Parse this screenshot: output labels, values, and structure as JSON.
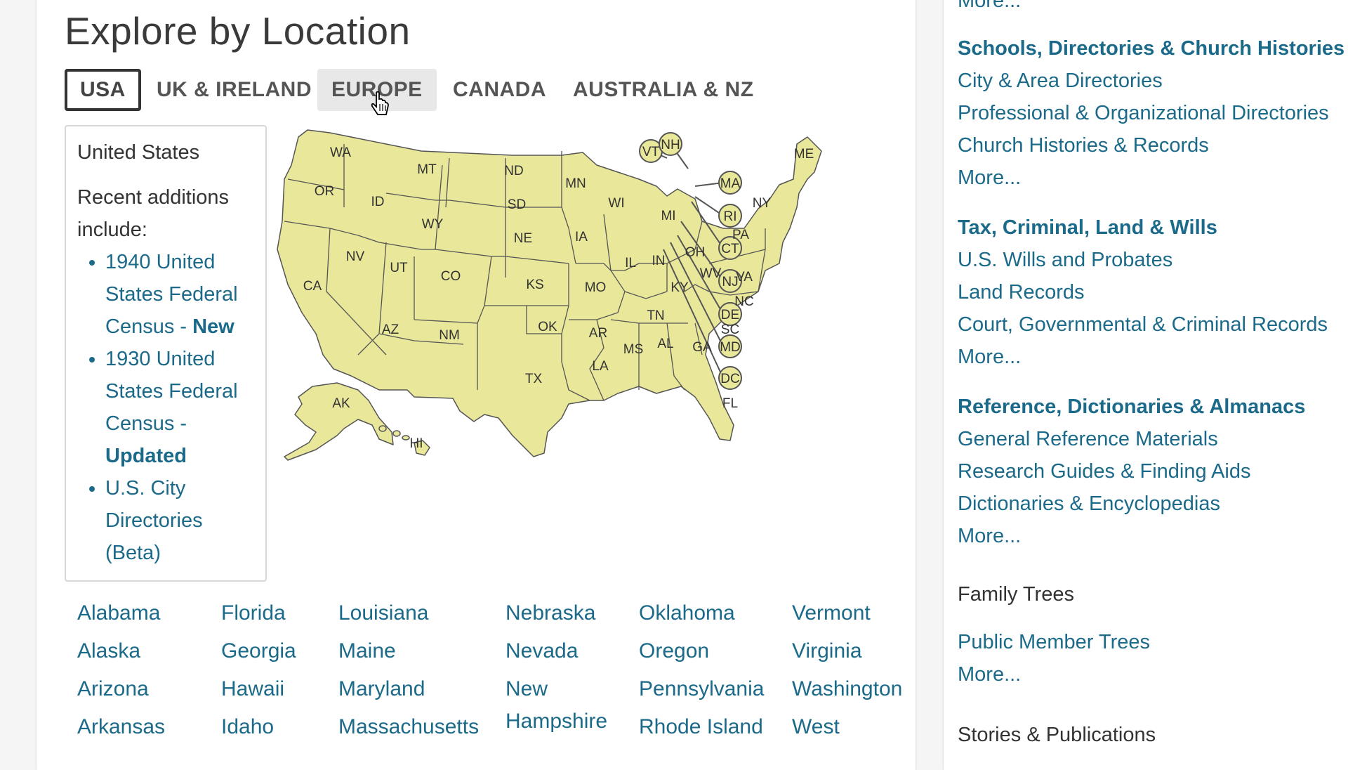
{
  "page": {
    "title": "Explore by Location",
    "tabs": [
      "USA",
      "UK & IRELAND",
      "EUROPE",
      "CANADA",
      "AUSTRALIA & NZ"
    ]
  },
  "info_box": {
    "heading": "United States",
    "intro": "Recent additions include:",
    "items": [
      {
        "text": "1940 United States Federal Census - ",
        "badge": "New"
      },
      {
        "text": "1930 United States Federal Census - ",
        "badge": "Updated"
      },
      {
        "text": "U.S. City Directories (Beta)",
        "badge": ""
      }
    ]
  },
  "map": {
    "states": [
      "WA",
      "OR",
      "CA",
      "ID",
      "NV",
      "MT",
      "WY",
      "UT",
      "AZ",
      "CO",
      "NM",
      "ND",
      "SD",
      "NE",
      "KS",
      "OK",
      "TX",
      "MN",
      "IA",
      "MO",
      "AR",
      "LA",
      "WI",
      "IL",
      "MS",
      "MI",
      "IN",
      "KY",
      "TN",
      "AL",
      "OH",
      "GA",
      "FL",
      "SC",
      "NC",
      "VA",
      "WV",
      "PA",
      "NY",
      "ME",
      "AK",
      "HI"
    ],
    "callouts": [
      "VT",
      "NH",
      "MA",
      "RI",
      "CT",
      "NJ",
      "DE",
      "MD",
      "DC"
    ],
    "fill_color": "#e8e79a",
    "stroke_color": "#555555"
  },
  "state_columns": [
    [
      "Alabama",
      "Alaska",
      "Arizona",
      "Arkansas"
    ],
    [
      "Florida",
      "Georgia",
      "Hawaii",
      "Idaho"
    ],
    [
      "Louisiana",
      "Maine",
      "Maryland",
      "Massachusetts"
    ],
    [
      "Nebraska",
      "Nevada",
      "New Hampshire"
    ],
    [
      "Oklahoma",
      "Oregon",
      "Pennsylvania",
      "Rhode Island"
    ],
    [
      "Vermont",
      "Virginia",
      "Washington",
      "West"
    ]
  ],
  "sidebar": {
    "top_more": "More...",
    "categories": [
      {
        "title": "Schools, Directories & Church Histories",
        "links": [
          "City & Area Directories",
          "Professional & Organizational Directories",
          "Church Histories & Records",
          "More..."
        ]
      },
      {
        "title": "Tax, Criminal, Land & Wills",
        "links": [
          "U.S. Wills and Probates",
          "Land Records",
          "Court, Governmental & Criminal Records",
          "More..."
        ]
      },
      {
        "title": "Reference, Dictionaries & Almanacs",
        "links": [
          "General Reference Materials",
          "Research Guides & Finding Aids",
          "Dictionaries & Encyclopedias",
          "More..."
        ]
      }
    ],
    "family_trees": {
      "title": "Family Trees",
      "links": [
        "Public Member Trees",
        "More..."
      ]
    },
    "stories": {
      "title": "Stories & Publications"
    }
  },
  "colors": {
    "link": "#1b6a8a",
    "map_fill": "#e8e79a",
    "panel": "#ffffff",
    "background": "#f5f5f5"
  }
}
